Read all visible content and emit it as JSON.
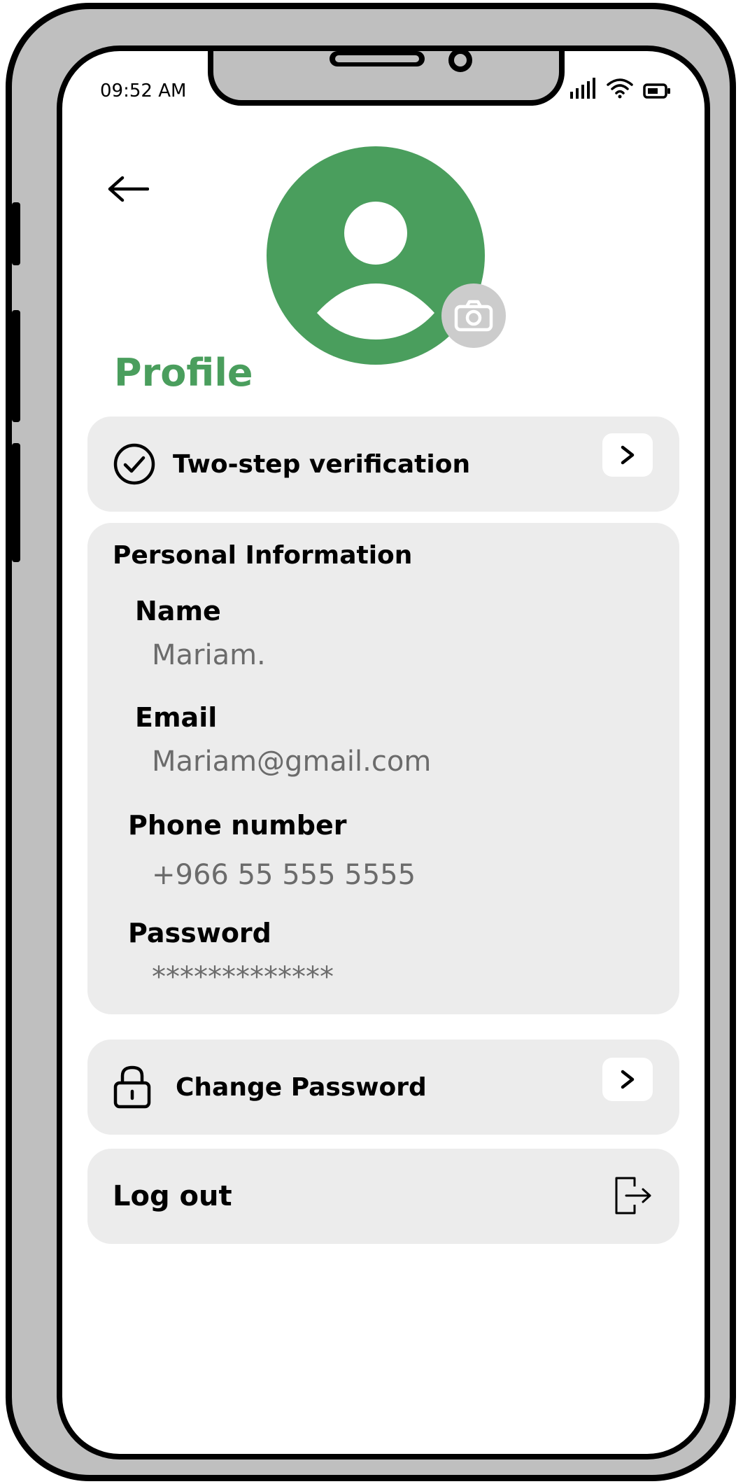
{
  "status_bar": {
    "time": "09:52 AM"
  },
  "page": {
    "title": "Profile"
  },
  "two_step": {
    "label": "Two-step verification"
  },
  "personal_info": {
    "title": "Personal Information",
    "fields": [
      {
        "label": "Name",
        "value": "Mariam."
      },
      {
        "label": "Email",
        "value": "Mariam@gmail.com"
      },
      {
        "label": "Phone number",
        "value": "+966 55 555 5555"
      },
      {
        "label": "Password",
        "value": "*************"
      }
    ]
  },
  "change_password": {
    "label": "Change Password"
  },
  "logout": {
    "label": "Log out"
  },
  "colors": {
    "accent": "#4a9e5d",
    "card": "#ececec",
    "muted_text": "#6b6b6b"
  }
}
